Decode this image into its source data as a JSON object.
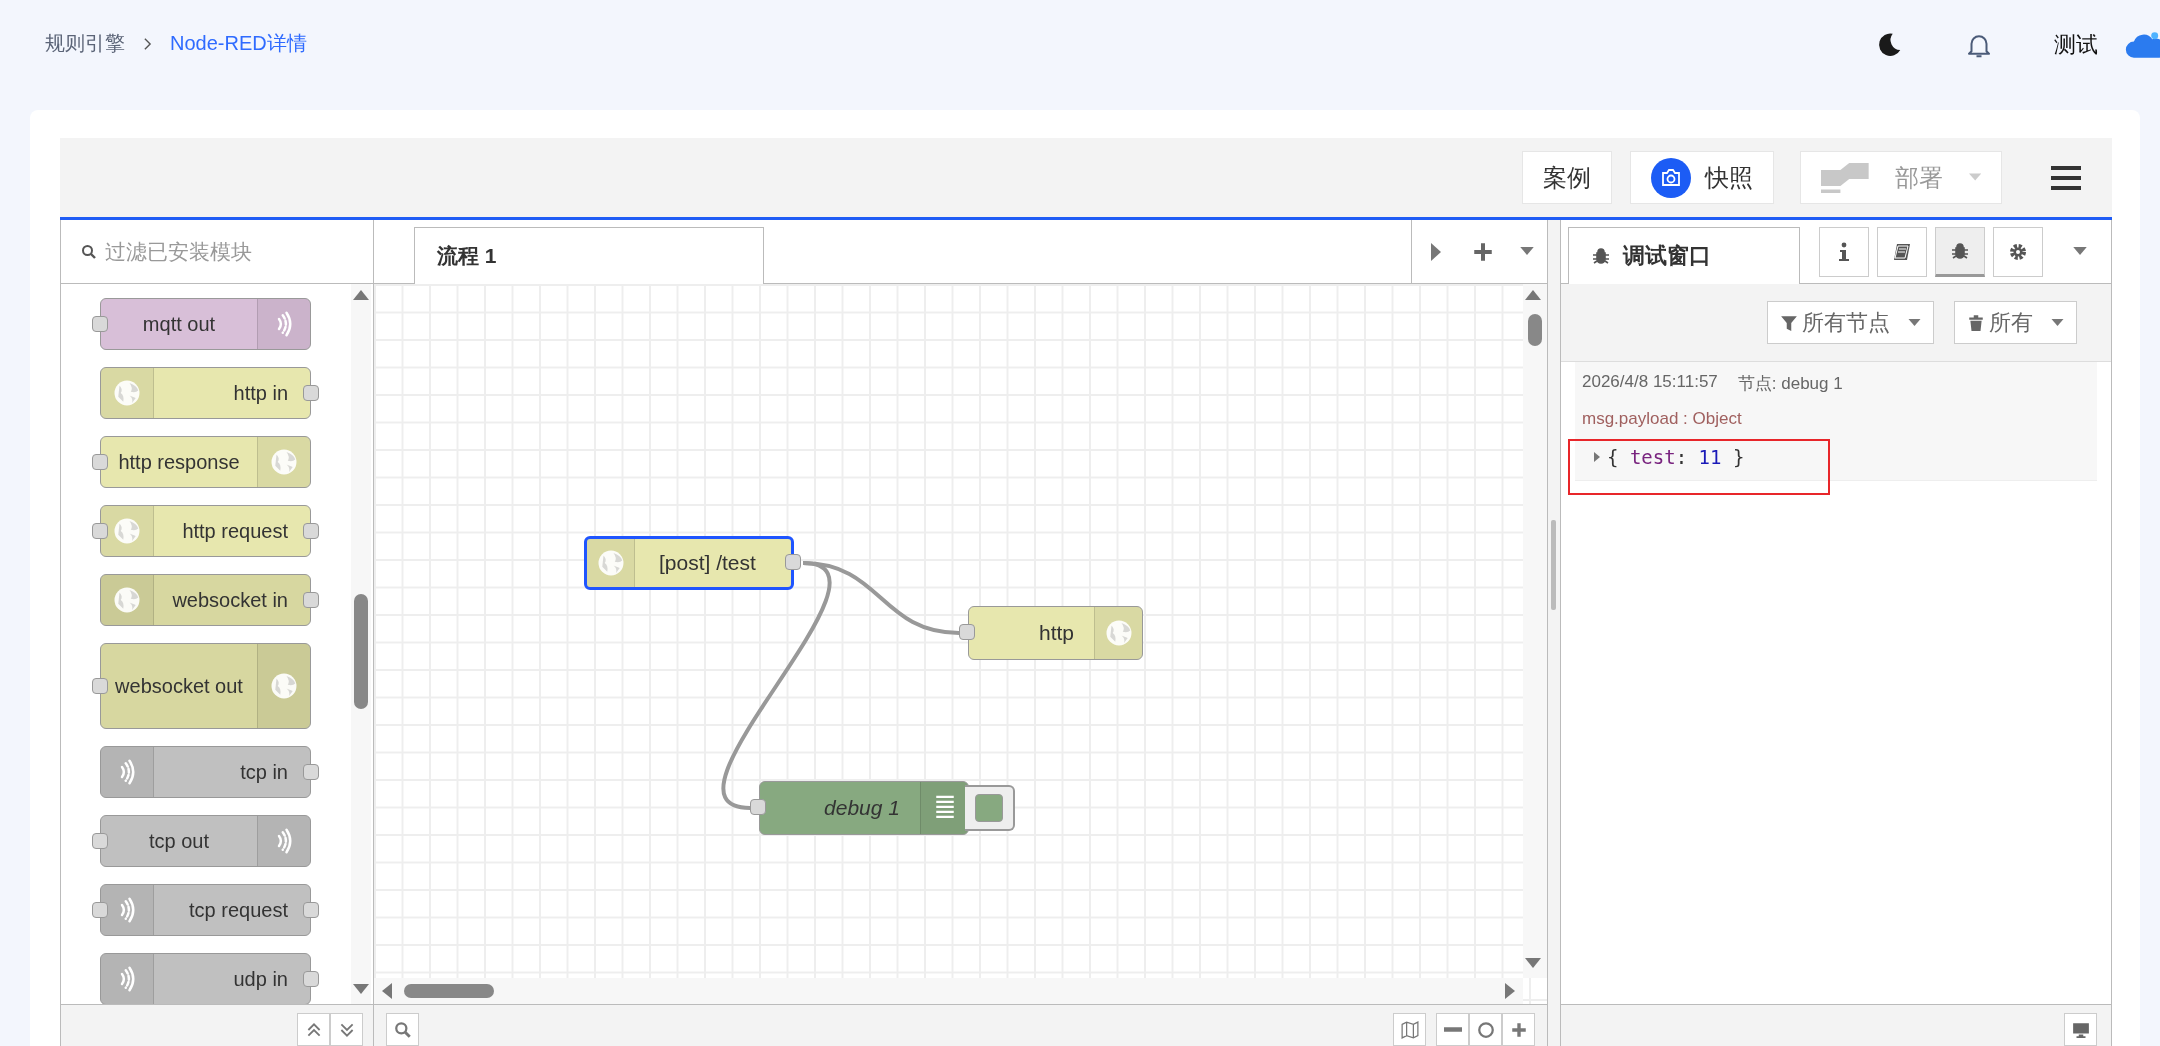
{
  "breadcrumb": [
    {
      "label": "规则引擎",
      "current": false
    },
    {
      "label": "Node-RED详情",
      "current": true
    }
  ],
  "header": {
    "user": "测试"
  },
  "toolbar": {
    "buttons": [
      {
        "label": "案例",
        "kind": "plain",
        "disabled": false
      },
      {
        "label": "快照",
        "kind": "camera",
        "disabled": false
      },
      {
        "label": "部署",
        "kind": "deploy",
        "disabled": true
      }
    ]
  },
  "palette": {
    "search": {
      "placeholder": "过滤已安装模块"
    },
    "nodes": [
      {
        "label": "mqtt out",
        "color": "#d8bfd8",
        "kind": "output"
      },
      {
        "label": "http in",
        "color": "#e7e7ae",
        "kind": "input"
      },
      {
        "label": "http response",
        "color": "#e7e7ae",
        "kind": "output"
      },
      {
        "label": "http request",
        "color": "#e7e7ae",
        "kind": "function"
      },
      {
        "label": "websocket in",
        "color": "#d7d7a0",
        "kind": "input"
      },
      {
        "label": "websocket out",
        "color": "#d7d7a0",
        "kind": "output"
      },
      {
        "label": "tcp in",
        "color": "#c0c0c0",
        "kind": "input"
      },
      {
        "label": "tcp out",
        "color": "#c0c0c0",
        "kind": "output"
      },
      {
        "label": "tcp request",
        "color": "#c0c0c0",
        "kind": "function"
      },
      {
        "label": "udp in",
        "color": "#c0c0c0",
        "kind": "input"
      }
    ]
  },
  "flow_tabs": [
    {
      "label": "流程 1",
      "selected": true
    }
  ],
  "canvas": {
    "nodes": [
      {
        "label": "[post] /test",
        "color": "#e7e7ae",
        "kind": "input",
        "selected": true
      },
      {
        "label": "http",
        "color": "#e7e7ae",
        "kind": "output",
        "selected": false
      },
      {
        "label": "debug 1",
        "color": "#87a980",
        "kind": "debug",
        "selected": false,
        "enabled": true
      }
    ]
  },
  "sidebar": {
    "tab": {
      "label": "调试窗口",
      "selected": true
    },
    "tab_buttons": [
      {
        "selected": false
      },
      {
        "selected": false
      },
      {
        "selected": true
      },
      {
        "selected": false
      }
    ],
    "filters": [
      {
        "label": "所有节点"
      },
      {
        "label": "所有"
      }
    ],
    "messages": [
      {
        "time": "2026/4/8 15:11:57",
        "node": "节点: debug 1",
        "topic": "msg.payload : Object",
        "expanded": false,
        "highlighted": true,
        "payload": {
          "open": "{",
          "key": "test",
          "sep": ":",
          "value": "11",
          "close": "}"
        }
      }
    ]
  }
}
